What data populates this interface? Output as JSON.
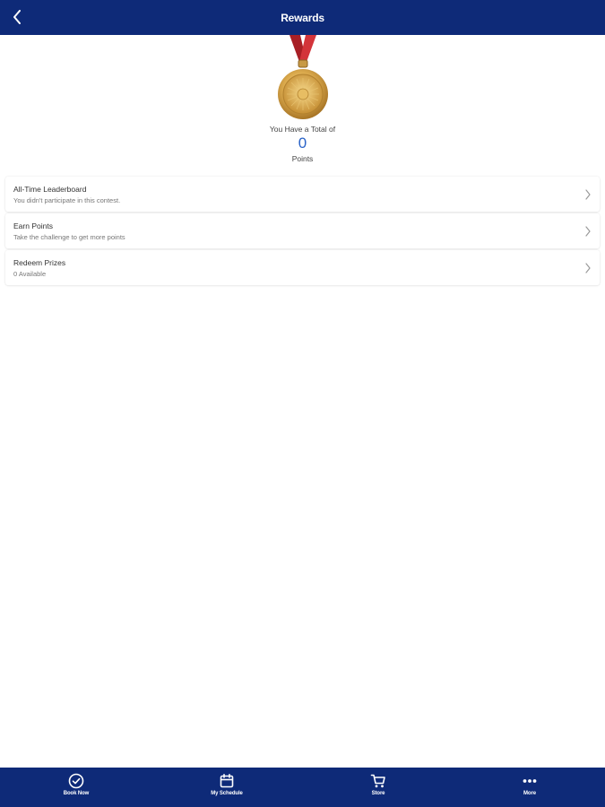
{
  "colors": {
    "header_bg": "#0e2a78",
    "tabbar_bg": "#0e2a78",
    "accent": "#2a63c8",
    "ribbon": "#c0282e",
    "medal_gold": "#d9a646"
  },
  "header": {
    "title": "Rewards",
    "back_icon": "chevron-left-icon"
  },
  "summary": {
    "medal_icon": "gold-medal-icon",
    "caption": "You Have a Total of",
    "points": "0",
    "unit": "Points"
  },
  "menu": {
    "items": [
      {
        "title": "All-Time Leaderboard",
        "subtitle": "You didn't participate in this contest.",
        "icon": "chevron-right-icon"
      },
      {
        "title": "Earn Points",
        "subtitle": "Take the challenge to get more points",
        "icon": "chevron-right-icon"
      },
      {
        "title": "Redeem Prizes",
        "subtitle": "0 Available",
        "icon": "chevron-right-icon"
      }
    ]
  },
  "tabbar": {
    "items": [
      {
        "label": "Book Now",
        "icon": "check-circle-icon"
      },
      {
        "label": "My Schedule",
        "icon": "calendar-icon"
      },
      {
        "label": "Store",
        "icon": "cart-icon"
      },
      {
        "label": "More",
        "icon": "more-dots-icon"
      }
    ]
  }
}
